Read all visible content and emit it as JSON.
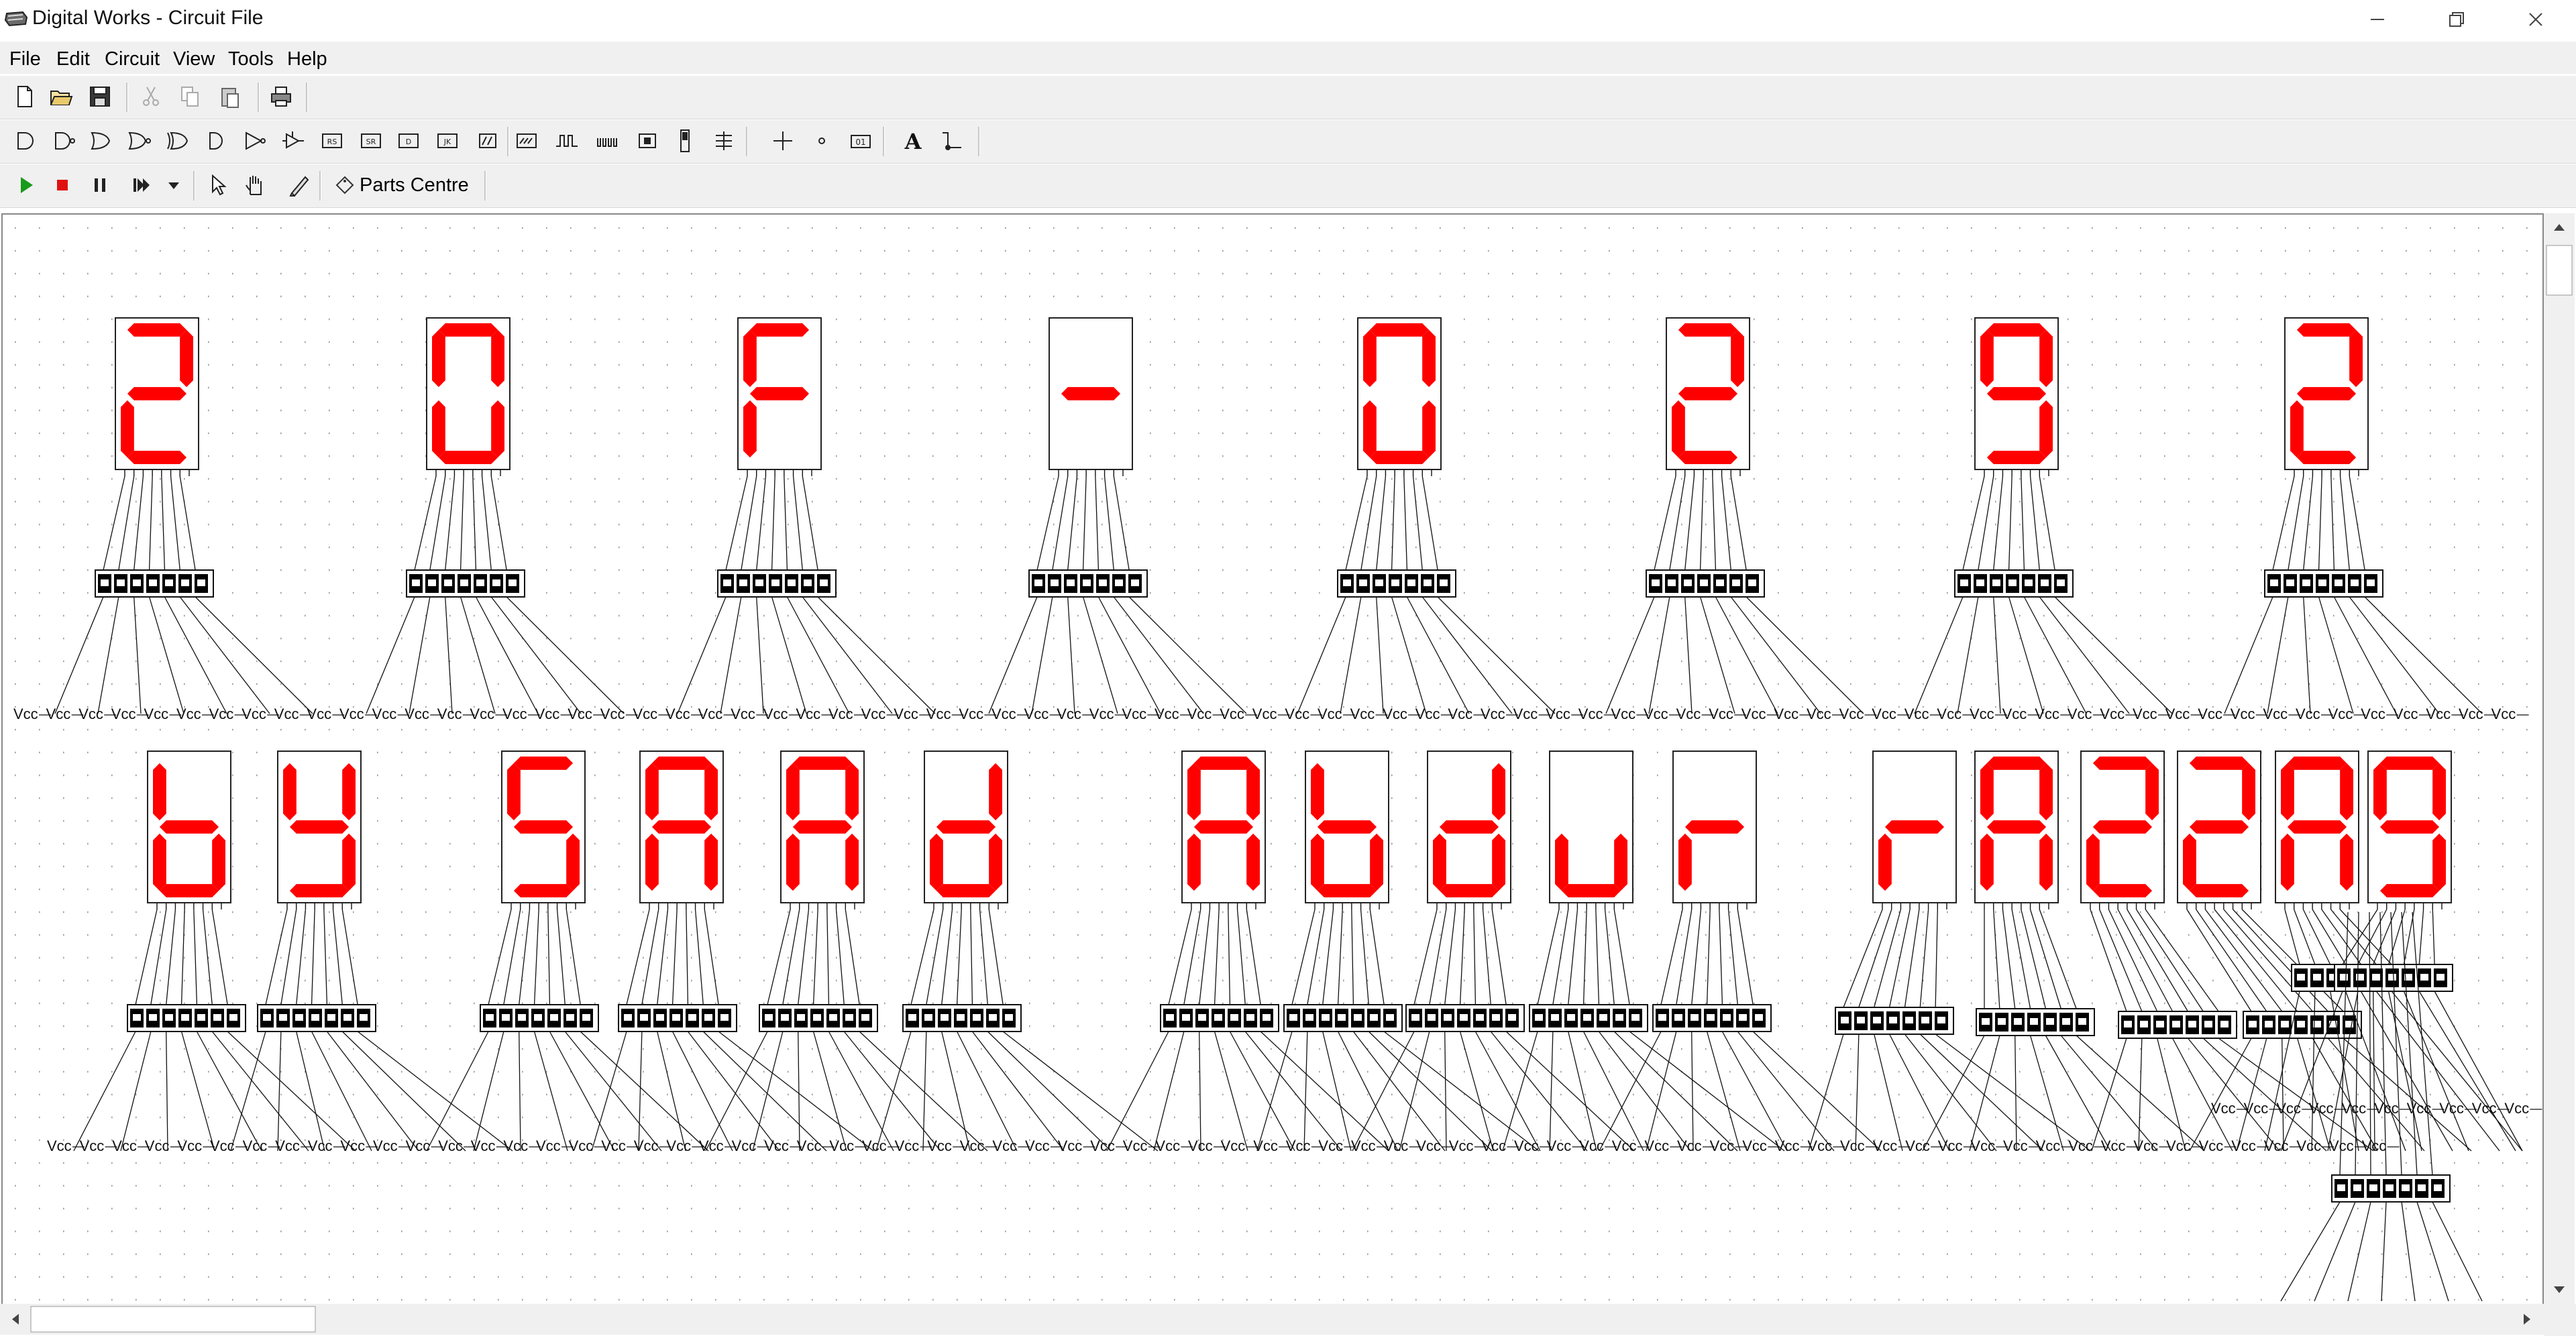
{
  "window": {
    "title": "Digital Works - Circuit File",
    "minimize_icon": "minimize-icon",
    "maximize_icon": "restore-icon",
    "close_icon": "close-icon"
  },
  "menu": [
    {
      "label": "File",
      "accel": "F"
    },
    {
      "label": "Edit",
      "accel": "E"
    },
    {
      "label": "Circuit",
      "accel": "C"
    },
    {
      "label": "View",
      "accel": "V"
    },
    {
      "label": "Tools",
      "accel": "T"
    },
    {
      "label": "Help",
      "accel": "H"
    }
  ],
  "toolbar": {
    "file_icons": [
      "new-file-icon",
      "open-folder-icon",
      "save-icon",
      "cut-icon",
      "copy-icon",
      "paste-icon",
      "print-icon"
    ],
    "gate_icons": [
      "and-gate-icon",
      "nand-gate-icon",
      "or-gate-icon",
      "nor-gate-icon",
      "xor-gate-icon",
      "buffer-icon",
      "inverter-icon",
      "tristate-icon",
      "rs-flipflop-icon",
      "sr-flipflop-icon",
      "d-flipflop-icon",
      "jk-flipflop-icon",
      "macro-icon",
      "clock-icon",
      "sequence-generator-icon",
      "switch-icon",
      "display-icon",
      "ground-icon",
      "vcc-icon",
      "led-icon",
      "seven-segment-icon",
      "binary-counter-icon",
      "text-icon",
      "wire-icon"
    ],
    "run_icons": [
      "play-icon",
      "stop-icon",
      "pause-icon",
      "step-icon",
      "dropdown-arrow-icon",
      "select-arrow-icon",
      "hand-icon",
      "probe-pen-icon"
    ],
    "parts_centre_label": "Parts Centre"
  },
  "circuit": {
    "supply_label": "Vcc",
    "row1_characters": [
      "2",
      "0",
      "F",
      "-",
      "0",
      "2",
      "9",
      "2"
    ],
    "row2_characters": [
      "b",
      "y",
      "S",
      "A",
      "A",
      "d",
      "A",
      "b",
      "d",
      "u",
      "r",
      "r",
      "A",
      "2",
      "2",
      "A",
      "9"
    ],
    "segment_color": "#ff0000",
    "switch_color": "#000000"
  }
}
